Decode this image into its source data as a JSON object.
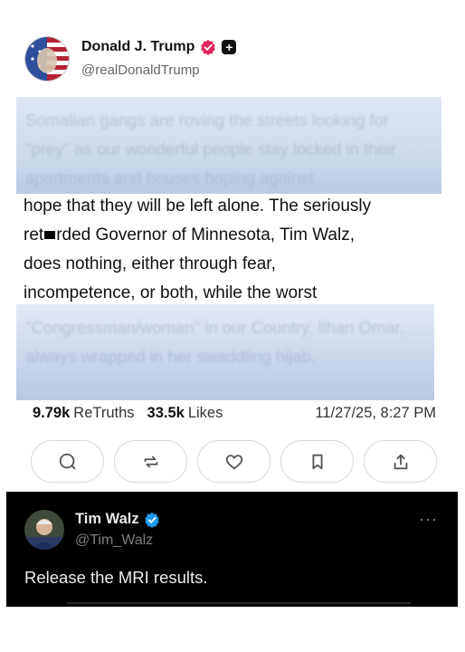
{
  "post": {
    "author_name": "Donald J. Trump",
    "author_handle": "@realDonaldTrump",
    "blurred_top": "Somalian gangs are roving the streets looking for \"prey\" as our wonderful people stay locked in their apartments and houses hoping against",
    "lines": [
      "hope that they will be left alone. The seriously",
      "ret",
      "rded Governor of Minnesota, Tim Walz,",
      "does nothing, either through fear,",
      "incompetence, or both, while the worst"
    ],
    "blurred_bottom": "\"Congressman/woman\" in our Country, Ilhan Omar, always wrapped in her swaddling hijab,",
    "retruths_count": "9.79k",
    "retruths_label": "ReTruths",
    "likes_count": "33.5k",
    "likes_label": "Likes",
    "timestamp": "11/27/25, 8:27 PM"
  },
  "actions": [
    "reply-icon",
    "retruth-icon",
    "heart-icon",
    "bookmark-icon",
    "share-icon"
  ],
  "reply": {
    "author_name": "Tim Walz",
    "author_handle": "@Tim_Walz",
    "text": "Release the MRI results.",
    "more": "···"
  },
  "colors": {
    "verified_red": "#e0245e",
    "verified_blue": "#1d9bf0",
    "reply_bg": "#000000"
  }
}
